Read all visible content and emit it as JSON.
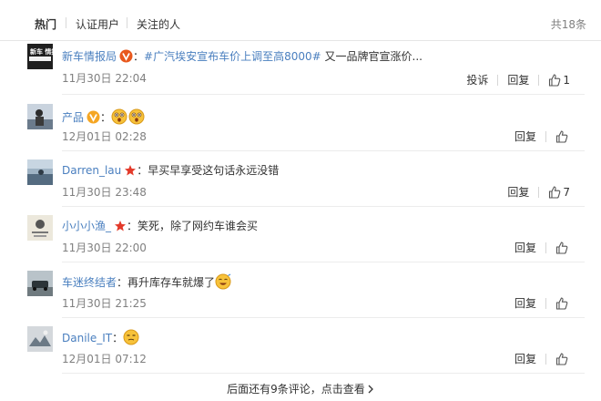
{
  "tabs": {
    "hot": "热门",
    "verified": "认证用户",
    "following": "关注的人"
  },
  "total": "共18条",
  "comments": [
    {
      "user": "新车情报局",
      "colon": "：",
      "topic": "#广汽埃安宣布车价上调至高8000#",
      "text": " 又一品牌官宣涨价...",
      "time": "11月30日 22:04",
      "report": "投诉",
      "reply": "回复",
      "likes": "1",
      "badge_color": "#e8581c",
      "avatar_text": "新车 情报局"
    },
    {
      "user": "产品",
      "colon": "：",
      "text": "",
      "time": "12月01日 02:28",
      "reply": "回复",
      "likes": "",
      "badge_color": "#f5a623",
      "emojis": [
        "surprised-emoji",
        "surprised-emoji"
      ]
    },
    {
      "user": "Darren_lau",
      "colon": "：",
      "text": "早买早享受这句话永远没错",
      "time": "11月30日 23:48",
      "reply": "回复",
      "likes": "7",
      "badge_color": "#e33a2a"
    },
    {
      "user": "小小小渔_",
      "colon": "：",
      "text": "笑死，除了网约车谁会买",
      "time": "11月30日 22:00",
      "reply": "回复",
      "likes": "",
      "badge_color": "#e33a2a"
    },
    {
      "user": "车迷终结者",
      "colon": "：",
      "text": "再升库存车就爆了",
      "time": "11月30日 21:25",
      "reply": "回复",
      "likes": "",
      "emojis": [
        "laugh-emoji"
      ]
    },
    {
      "user": "Danile_IT",
      "colon": "：",
      "text": "",
      "time": "12月01日 07:12",
      "reply": "回复",
      "likes": "",
      "emojis": [
        "smirk-emoji"
      ]
    }
  ],
  "footer": {
    "more_label": "后面还有9条评论，点击查看"
  },
  "colors": {
    "link": "#4a7fbf",
    "meta": "#808080",
    "divider": "#ececec"
  }
}
